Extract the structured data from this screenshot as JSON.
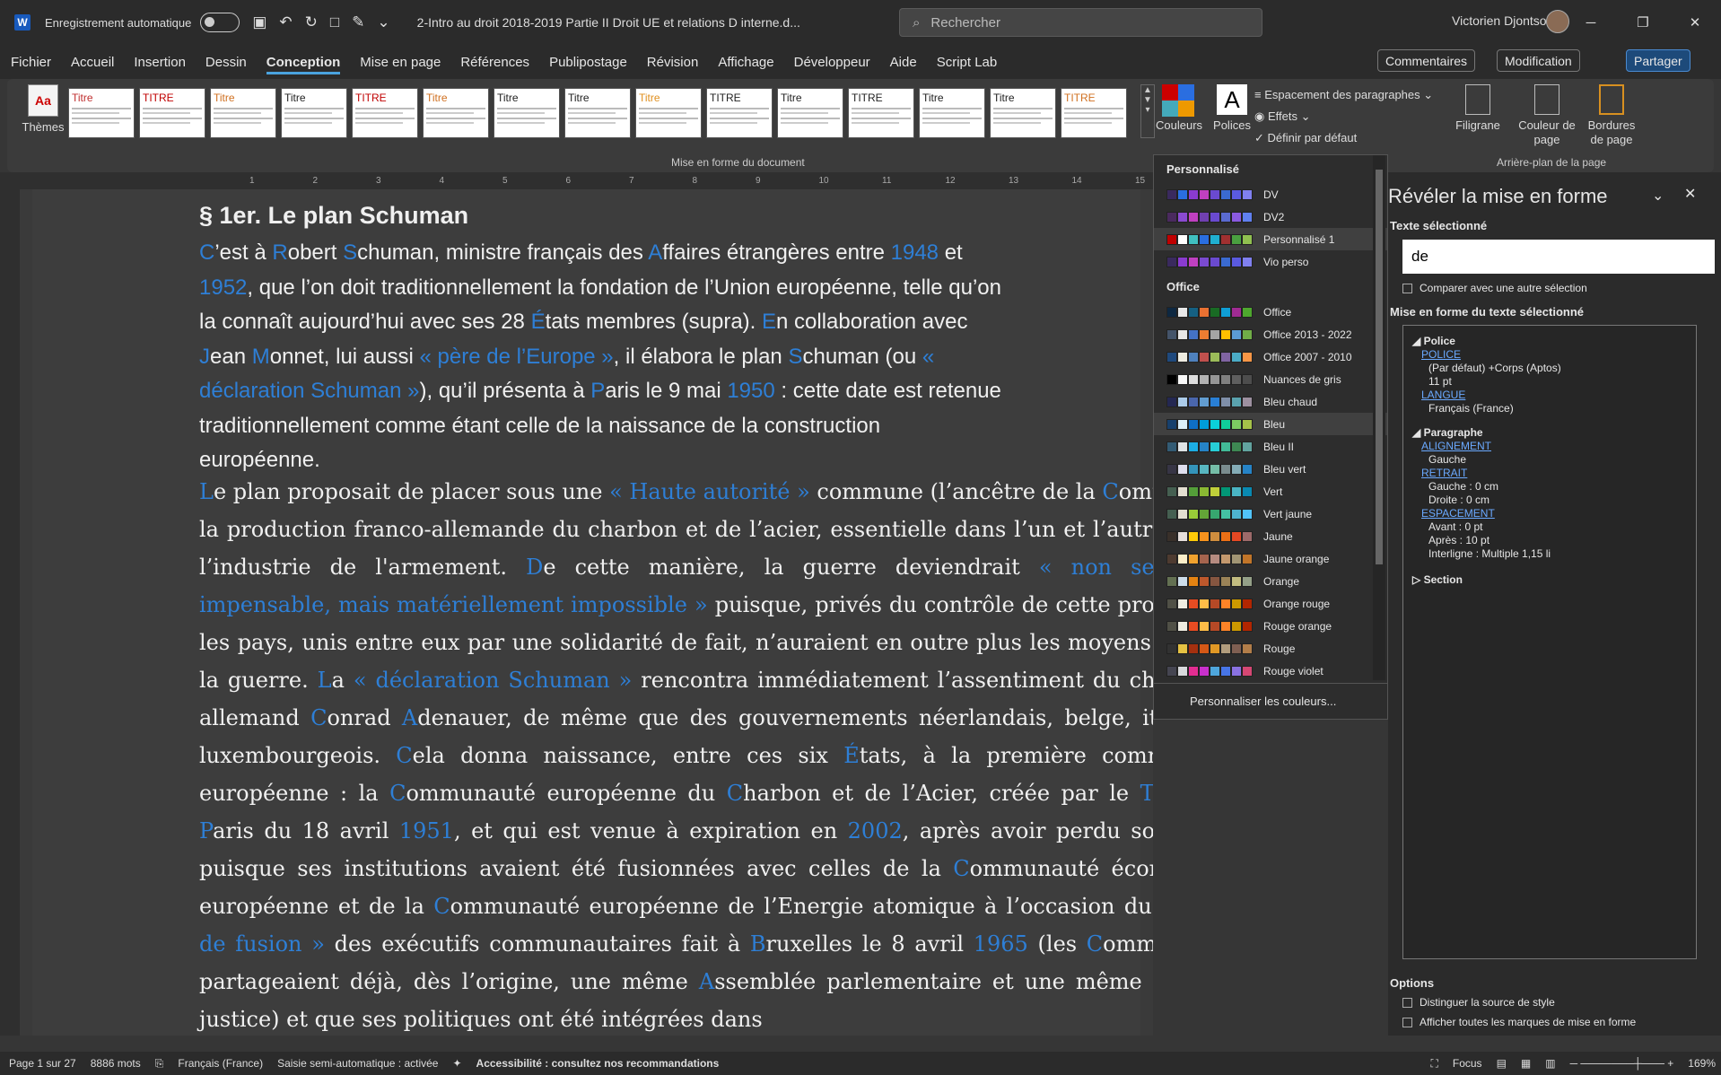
{
  "window": {
    "title": "2-Intro au droit 2018-2019 Partie II Droit  UE et relations D interne.d...",
    "autosave_label": "Enregistrement automatique",
    "search_placeholder": "Rechercher",
    "user": "Victorien Djontso"
  },
  "menu": [
    "Fichier",
    "Accueil",
    "Insertion",
    "Dessin",
    "Conception",
    "Mise en page",
    "Références",
    "Publipostage",
    "Révision",
    "Affichage",
    "Développeur",
    "Aide",
    "Script Lab"
  ],
  "menu_active": "Conception",
  "ribbon_right": {
    "comments": "Commentaires",
    "modification": "Modification",
    "share": "Partager"
  },
  "ribbon": {
    "themes": "Thèmes",
    "gallery": [
      {
        "t": "Titre"
      },
      {
        "t": "TITRE"
      },
      {
        "t": "Titre"
      },
      {
        "t": "Titre"
      },
      {
        "t": "TITRE"
      },
      {
        "t": "Titre"
      },
      {
        "t": "Titre"
      },
      {
        "t": "Titre"
      },
      {
        "t": "Titre"
      },
      {
        "t": "TITRE"
      },
      {
        "t": "Titre"
      },
      {
        "t": "TITRE"
      },
      {
        "t": "Titre"
      },
      {
        "t": "Titre"
      },
      {
        "t": "TITRE"
      }
    ],
    "group_format": "Mise en forme du document",
    "colors": "Couleurs",
    "fonts": "Polices",
    "para_spacing": "Espacement des paragraphes",
    "effects": "Effets",
    "set_default": "Définir par défaut",
    "watermark": "Filigrane",
    "page_color": "Couleur de page",
    "page_borders": "Bordures de page",
    "group_bg": "Arrière-plan de la page"
  },
  "ruler": [
    "1",
    "2",
    "3",
    "4",
    "5",
    "6",
    "7",
    "8",
    "9",
    "10",
    "11",
    "12",
    "13",
    "14",
    "15"
  ],
  "doc": {
    "heading": "§ 1er. Le plan Schuman",
    "p1": [
      {
        "t": "C",
        "b": true
      },
      {
        "t": "’est à "
      },
      {
        "t": "R",
        "b": true
      },
      {
        "t": "obert "
      },
      {
        "t": "S",
        "b": true
      },
      {
        "t": "chuman, ministre français des "
      },
      {
        "t": "A",
        "b": true
      },
      {
        "t": "ffaires étrangères entre "
      },
      {
        "t": "1948",
        "b": true
      },
      {
        "t": " et "
      },
      {
        "t": "1952",
        "b": true
      },
      {
        "t": ", que l’on doit traditionnellement la fondation de l’Union européenne, telle qu’on la connaît aujourd’hui avec ses 28 "
      },
      {
        "t": "É",
        "b": true
      },
      {
        "t": "tats membres (supra). "
      },
      {
        "t": "E",
        "b": true
      },
      {
        "t": "n collaboration avec "
      },
      {
        "t": "J",
        "b": true
      },
      {
        "t": "ean "
      },
      {
        "t": "M",
        "b": true
      },
      {
        "t": "onnet, lui aussi "
      },
      {
        "t": "« père de l’Europe »",
        "b": true
      },
      {
        "t": ", il élabora le plan "
      },
      {
        "t": "S",
        "b": true
      },
      {
        "t": "chuman (ou "
      },
      {
        "t": "« déclaration Schuman »",
        "b": true
      },
      {
        "t": "), qu’il présenta à "
      },
      {
        "t": "P",
        "b": true
      },
      {
        "t": "aris le 9 mai "
      },
      {
        "t": "1950",
        "b": true
      },
      {
        "t": " : cette date est retenue traditionnellement comme étant celle de la naissance de la construction européenne."
      }
    ],
    "p2": [
      {
        "t": "L",
        "b": true
      },
      {
        "t": "e plan proposait de placer sous une "
      },
      {
        "t": "« Haute autorité »",
        "b": true
      },
      {
        "t": " commune (l’ancêtre de la "
      },
      {
        "t": "C",
        "b": true
      },
      {
        "t": "ommission) la production franco-allemande du charbon et de l’acier, essentielle dans l’un et l’autre pays à l’industrie de l'armement. "
      },
      {
        "t": "D",
        "b": true
      },
      {
        "t": "e cette manière, la guerre deviendrait "
      },
      {
        "t": "« non seulement impensable, mais matériellement impossible »",
        "b": true
      },
      {
        "t": " puisque, privés du contrôle de cette production, les pays, unis entre eux par une solidarité de fait, n’auraient en outre plus les moyens de faire la guerre. "
      },
      {
        "t": "L",
        "b": true
      },
      {
        "t": "a "
      },
      {
        "t": "« déclaration Schuman »",
        "b": true
      },
      {
        "t": " rencontra immédiatement l’assentiment du chancelier allemand "
      },
      {
        "t": "C",
        "b": true
      },
      {
        "t": "onrad "
      },
      {
        "t": "A",
        "b": true
      },
      {
        "t": "denauer, de même que des gouvernements néerlandais, belge, italien et luxembourgeois. "
      },
      {
        "t": "C",
        "b": true
      },
      {
        "t": "ela donna naissance, entre ces six "
      },
      {
        "t": "É",
        "b": true
      },
      {
        "t": "tats, à la première communauté européenne : la "
      },
      {
        "t": "C",
        "b": true
      },
      {
        "t": "ommunauté européenne du "
      },
      {
        "t": "C",
        "b": true
      },
      {
        "t": "harbon et de l’Acier, créée par le "
      },
      {
        "t": "T",
        "b": true
      },
      {
        "t": "raité de "
      },
      {
        "t": "P",
        "b": true
      },
      {
        "t": "aris du 18 avril "
      },
      {
        "t": "1951",
        "b": true
      },
      {
        "t": ", et qui est venue à expiration en "
      },
      {
        "t": "2002",
        "b": true
      },
      {
        "t": ", après avoir perdu son utilité puisque ses institutions avaient été fusionnées avec celles de la "
      },
      {
        "t": "C",
        "b": true
      },
      {
        "t": "ommunauté économique européenne et de la "
      },
      {
        "t": "C",
        "b": true
      },
      {
        "t": "ommunauté européenne de l’Energie atomique à l’occasion du "
      },
      {
        "t": "« traité de fusion »",
        "b": true
      },
      {
        "t": " des exécutifs communautaires fait à "
      },
      {
        "t": "B",
        "b": true
      },
      {
        "t": "ruxelles le 8 avril "
      },
      {
        "t": "1965",
        "b": true
      },
      {
        "t": " (les "
      },
      {
        "t": "C",
        "b": true
      },
      {
        "t": "ommunautés partageaient déjà, dès l’origine, une même "
      },
      {
        "t": "A",
        "b": true
      },
      {
        "t": "ssemblée parlementaire et une même "
      },
      {
        "t": "C",
        "b": true
      },
      {
        "t": "our de justice) et que ses politiques ont été intégrées dans"
      }
    ]
  },
  "colors_popup": {
    "sec_custom": "Personnalisé",
    "custom": [
      {
        "name": "DV",
        "c": [
          "#3a2a5e",
          "#2a6ee0",
          "#8a3bd0",
          "#c040c0",
          "#6a4ad0",
          "#3a6ad0",
          "#5a5ae0",
          "#8080f0"
        ]
      },
      {
        "name": "DV2",
        "c": [
          "#4a2a5e",
          "#8a4ad0",
          "#c040c0",
          "#7040b0",
          "#6a4ad0",
          "#5a6ad0",
          "#8a5ae0",
          "#6080f0"
        ]
      },
      {
        "name": "Personnalisé 1",
        "c": [
          "#c00000",
          "#ffffff",
          "#40c0c0",
          "#2a6ee0",
          "#20b0d0",
          "#a03030",
          "#4aa040",
          "#90c050"
        ]
      },
      {
        "name": "Vio perso",
        "c": [
          "#3a2a5e",
          "#8a3bd0",
          "#c040c0",
          "#7a4ad0",
          "#6a4ad0",
          "#3a6ad0",
          "#5a5ae0",
          "#8080f0"
        ]
      }
    ],
    "sec_office": "Office",
    "office": [
      {
        "name": "Office",
        "c": [
          "#0e2841",
          "#e8e8e8",
          "#156082",
          "#e97132",
          "#196b24",
          "#0f9ed5",
          "#a02b93",
          "#4ea72e"
        ]
      },
      {
        "name": "Office 2013 - 2022",
        "c": [
          "#44546a",
          "#e7e6e6",
          "#4472c4",
          "#ed7d31",
          "#a5a5a5",
          "#ffc000",
          "#5b9bd5",
          "#70ad47"
        ]
      },
      {
        "name": "Office 2007 - 2010",
        "c": [
          "#1f497d",
          "#eeece1",
          "#4f81bd",
          "#c0504d",
          "#9bbb59",
          "#8064a2",
          "#4bacc6",
          "#f79646"
        ]
      },
      {
        "name": "Nuances de gris",
        "c": [
          "#000000",
          "#f8f8f8",
          "#dddddd",
          "#b2b2b2",
          "#969696",
          "#808080",
          "#5f5f5f",
          "#4d4d4d"
        ]
      },
      {
        "name": "Bleu chaud",
        "c": [
          "#242852",
          "#acccea",
          "#4a66ac",
          "#629dd1",
          "#297fd5",
          "#7f8fa9",
          "#5aa2ae",
          "#9d90a0"
        ]
      },
      {
        "name": "Bleu",
        "c": [
          "#17406d",
          "#dbeff9",
          "#0f6fc6",
          "#009dd9",
          "#0bd0d9",
          "#10cf9b",
          "#7cca62",
          "#a5c249"
        ]
      },
      {
        "name": "Bleu II",
        "c": [
          "#335b74",
          "#dfe3e5",
          "#1cade4",
          "#2683c6",
          "#27ced7",
          "#42ba97",
          "#3e8853",
          "#62a39f"
        ]
      },
      {
        "name": "Bleu vert",
        "c": [
          "#373545",
          "#dedeed",
          "#3494ba",
          "#58b6c0",
          "#75bda7",
          "#7a8c8e",
          "#84acb6",
          "#2683c6"
        ]
      },
      {
        "name": "Vert",
        "c": [
          "#455f51",
          "#e3ded1",
          "#549e39",
          "#8ab833",
          "#c0cf3a",
          "#029676",
          "#4ab5c4",
          "#0989b1"
        ]
      },
      {
        "name": "Vert jaune",
        "c": [
          "#455f51",
          "#e3ded1",
          "#99cb38",
          "#63a537",
          "#37a76f",
          "#44c1a3",
          "#4eb3cf",
          "#51c3f9"
        ]
      },
      {
        "name": "Jaune",
        "c": [
          "#39302a",
          "#e5dedb",
          "#ffca08",
          "#f8931d",
          "#ce8d3e",
          "#ec7016",
          "#e64823",
          "#9c6a6a"
        ]
      },
      {
        "name": "Jaune orange",
        "c": [
          "#4e3b30",
          "#fbeec9",
          "#f0a22e",
          "#a5644e",
          "#b58b80",
          "#c3986d",
          "#a19574",
          "#c17529"
        ]
      },
      {
        "name": "Orange",
        "c": [
          "#637052",
          "#ccddea",
          "#e48312",
          "#bd582c",
          "#865640",
          "#9b8357",
          "#c2bc80",
          "#94a088"
        ]
      },
      {
        "name": "Orange rouge",
        "c": [
          "#505046",
          "#eeece1",
          "#e84c22",
          "#ffbd47",
          "#b64926",
          "#ff8427",
          "#cc9900",
          "#b22600"
        ]
      },
      {
        "name": "Rouge orange",
        "c": [
          "#505046",
          "#eeece1",
          "#e84c22",
          "#ffbd47",
          "#b64926",
          "#ff8427",
          "#cc9900",
          "#b22600"
        ]
      },
      {
        "name": "Rouge",
        "c": [
          "#323232",
          "#e5c243",
          "#a5300f",
          "#d55816",
          "#e19825",
          "#b19c7d",
          "#7f5f52",
          "#b27d49"
        ]
      },
      {
        "name": "Rouge violet",
        "c": [
          "#454551",
          "#d8d9dc",
          "#e32d91",
          "#c830cc",
          "#4ea6dc",
          "#4775e7",
          "#8971e1",
          "#d54773"
        ]
      }
    ],
    "customize": "Personnaliser les couleurs..."
  },
  "pane": {
    "title": "Révéler la mise en forme",
    "selected_text_label": "Texte sélectionné",
    "selected_text": "de",
    "compare_label": "Comparer avec une autre sélection",
    "format_label": "Mise en forme du texte sélectionné",
    "tree": {
      "police_h": "Police",
      "police_link": "POLICE",
      "police_v1": "(Par défaut) +Corps (Aptos)",
      "police_v2": "11 pt",
      "langue_link": "LANGUE",
      "langue_v": "Français (France)",
      "para_h": "Paragraphe",
      "align_link": "ALIGNEMENT",
      "align_v": "Gauche",
      "retrait_link": "RETRAIT",
      "retrait_v1": "Gauche :  0 cm",
      "retrait_v2": "Droite :  0 cm",
      "esp_link": "ESPACEMENT",
      "esp_v1": "Avant : 0 pt",
      "esp_v2": "Après : 10 pt",
      "esp_v3": "Interligne : Multiple 1,15 li",
      "section_h": "Section"
    },
    "options_label": "Options",
    "opt1": "Distinguer la source de style",
    "opt2": "Afficher toutes les marques de mise en forme"
  },
  "status": {
    "page": "Page 1 sur 27",
    "words": "8886 mots",
    "lang": "Français (France)",
    "input": "Saisie semi-automatique : activée",
    "access": "Accessibilité : consultez nos recommandations",
    "focus": "Focus",
    "zoom": "169%"
  }
}
